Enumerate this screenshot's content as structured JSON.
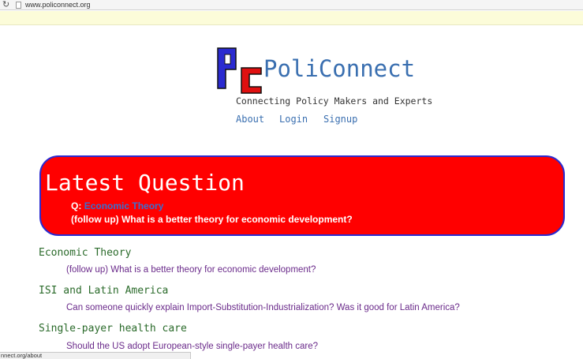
{
  "browser": {
    "url": "www.policonnect.org",
    "status_url": "nnect.org/about"
  },
  "header": {
    "brand": "PoliConnect",
    "tagline": "Connecting Policy Makers and Experts",
    "nav": [
      "About",
      "Login",
      "Signup"
    ]
  },
  "latest": {
    "title": "Latest Question",
    "q_prefix": "Q:",
    "q_topic": "Economic Theory",
    "q_text": "(follow up) What is a better theory for economic development?"
  },
  "questions": [
    {
      "topic": "Economic Theory",
      "text": "(follow up) What is a better theory for economic development?"
    },
    {
      "topic": "ISI and Latin America",
      "text": "Can someone quickly explain Import-Substitution-Industrialization? Was it good for Latin America?"
    },
    {
      "topic": "Single-payer health care",
      "text": "Should the US adopt European-style single-payer health care?"
    }
  ],
  "colors": {
    "brand_blue": "#3a6fb0",
    "banner_red": "#ff0000",
    "banner_border": "#2a2ad0",
    "topic_green": "#2a6a2a",
    "question_purple": "#6a2a8a",
    "logo_p": "#2a2ad0",
    "logo_c": "#e01010"
  }
}
